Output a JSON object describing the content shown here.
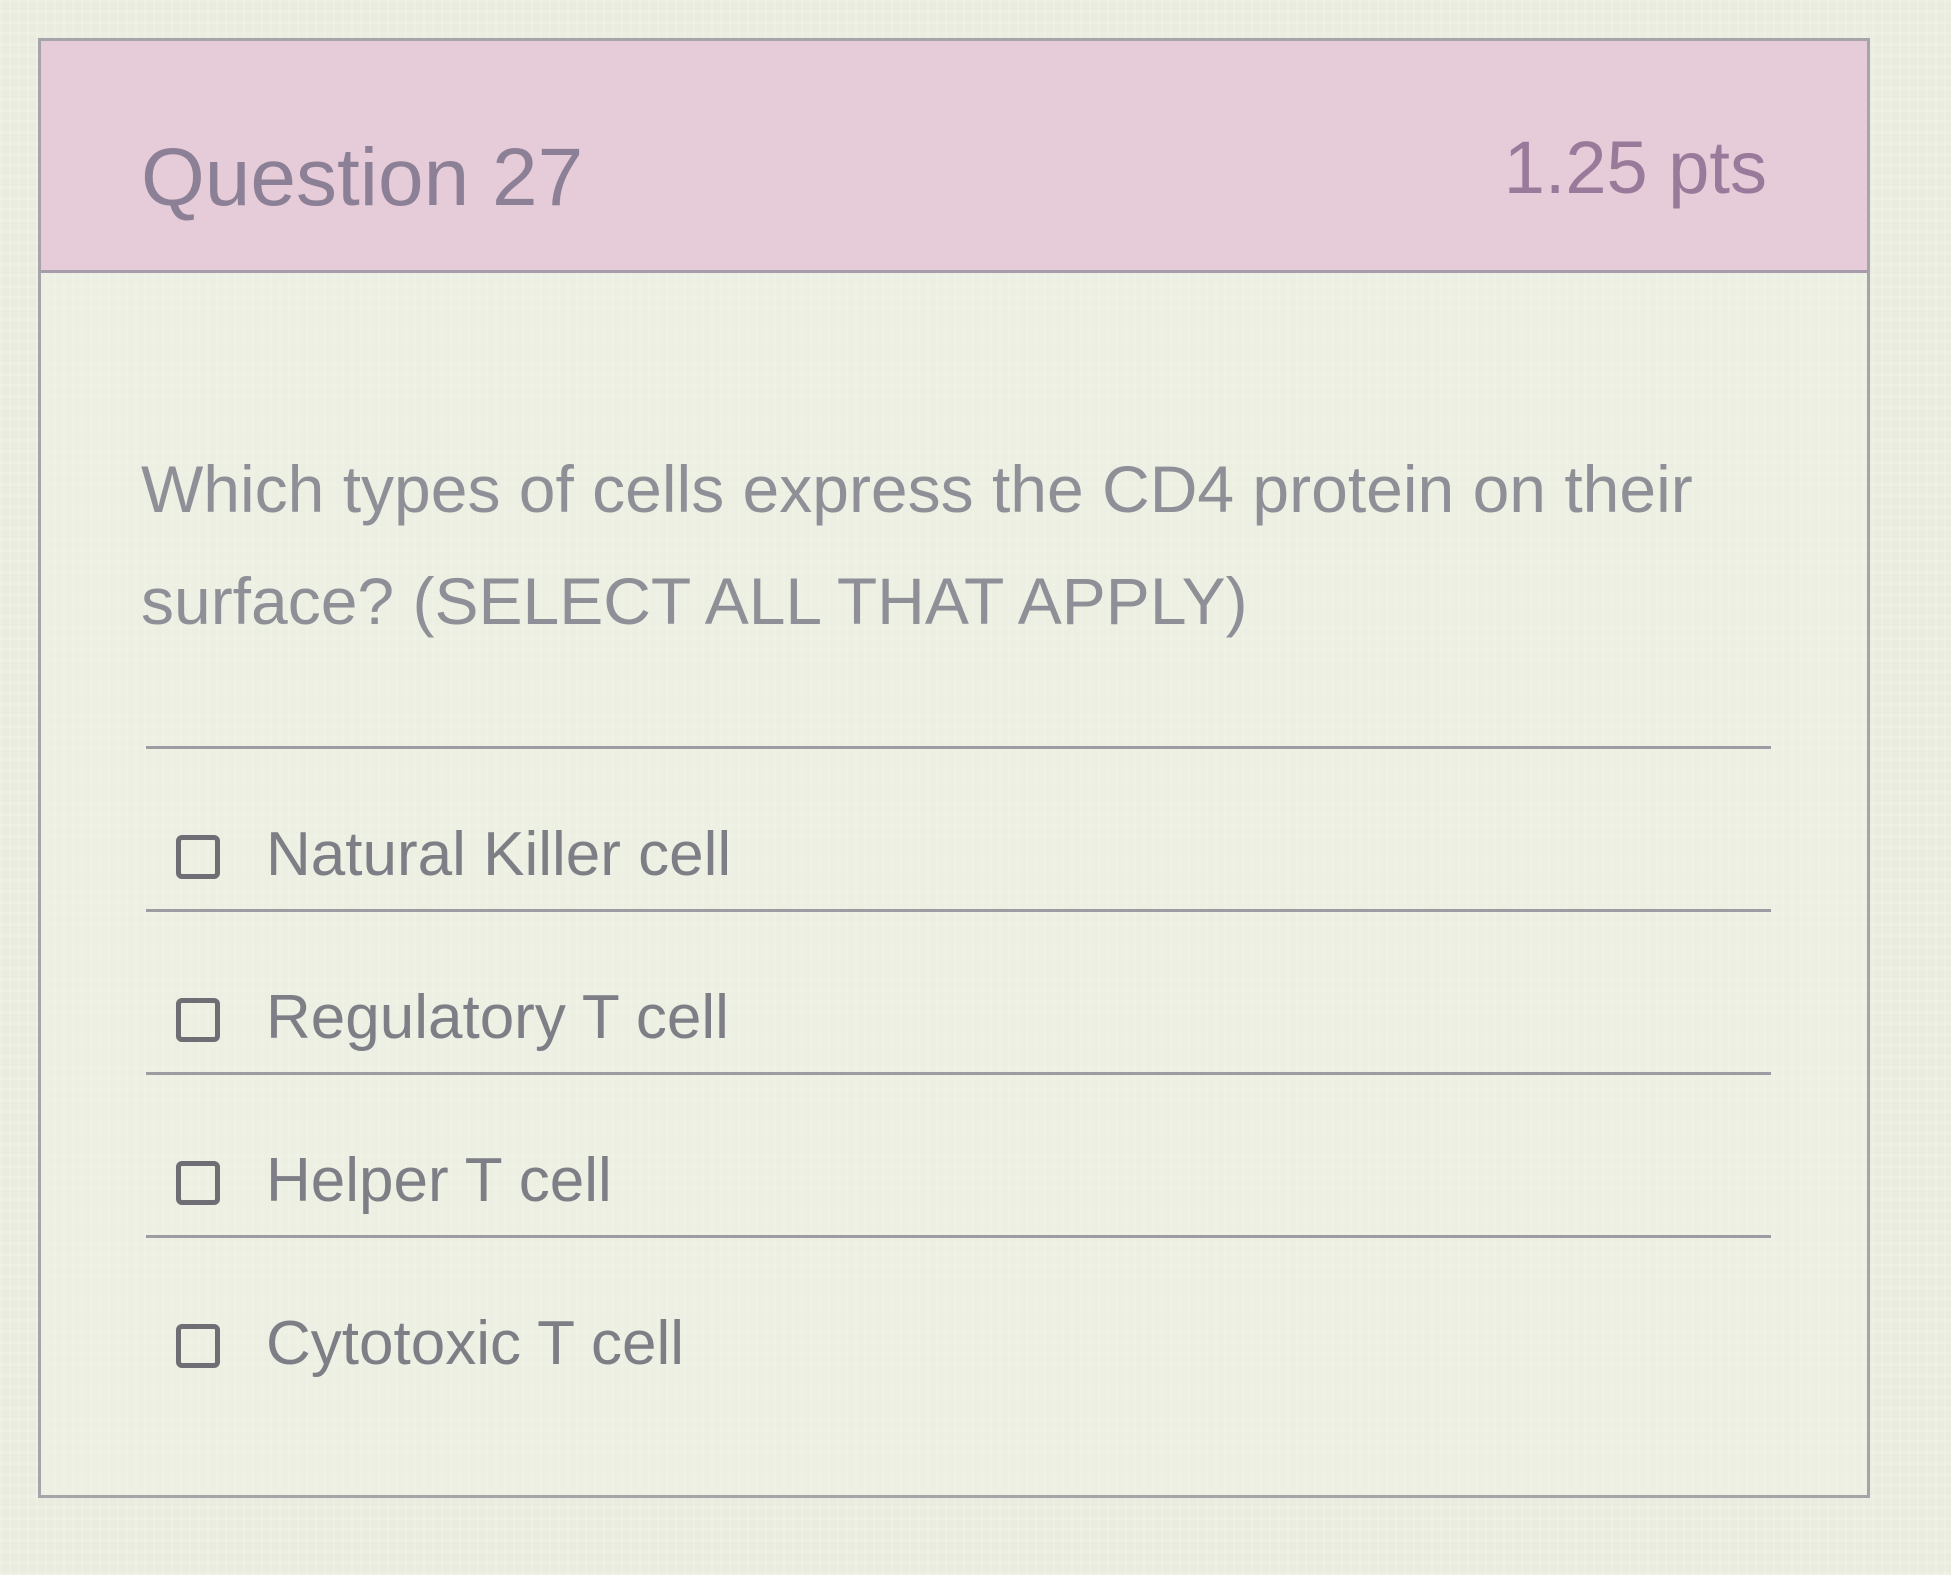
{
  "question": {
    "title": "Question 27",
    "points": "1.25 pts",
    "text": "Which types of cells express the CD4 protein on their surface? (SELECT ALL THAT APPLY)"
  },
  "answers": [
    {
      "label": "Natural Killer cell",
      "checked": false
    },
    {
      "label": "Regulatory T cell",
      "checked": false
    },
    {
      "label": "Helper T cell",
      "checked": false
    },
    {
      "label": "Cytotoxic T cell",
      "checked": false
    }
  ],
  "colors": {
    "header_bg": "#e6cbd8",
    "header_text": "#8c8096",
    "body_text": "#8f8f98",
    "border": "#a6a4a8"
  }
}
